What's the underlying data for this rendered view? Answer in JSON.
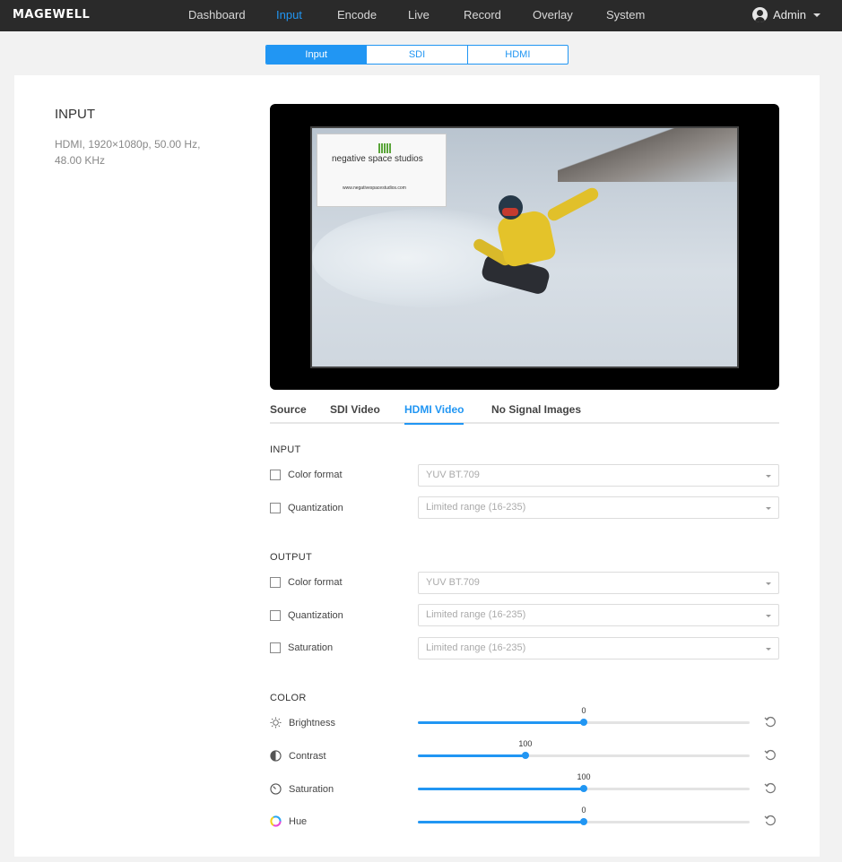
{
  "brand": "MAGEWELL",
  "nav": {
    "items": [
      "Dashboard",
      "Input",
      "Encode",
      "Live",
      "Record",
      "Overlay",
      "System"
    ],
    "active": "Input",
    "user": "Admin"
  },
  "segment_tabs": [
    "Input",
    "SDI",
    "HDMI"
  ],
  "segment_active": "Input",
  "side": {
    "title": "INPUT",
    "info": "HDMI, 1920×1080p, 50.00 Hz, 48.00 KHz"
  },
  "preview": {
    "logo_title": "negative space studios",
    "logo_url": "www.negativespacestudios.com"
  },
  "content_tabs": [
    "Source",
    "SDI Video",
    "HDMI Video",
    "No Signal Images"
  ],
  "content_tab_active": "HDMI Video",
  "input_section": {
    "label": "INPUT",
    "rows": [
      {
        "label": "Color format",
        "value": "YUV BT.709"
      },
      {
        "label": "Quantization",
        "value": "Limited range (16-235)"
      }
    ]
  },
  "output_section": {
    "label": "OUTPUT",
    "rows": [
      {
        "label": "Color format",
        "value": "YUV BT.709"
      },
      {
        "label": "Quantization",
        "value": "Limited range (16-235)"
      },
      {
        "label": "Saturation",
        "value": "Limited range (16-235)"
      }
    ]
  },
  "color_section": {
    "label": "COLOR",
    "sliders": [
      {
        "label": "Brightness",
        "value": "0",
        "fraction": 0.5,
        "icon": "sun-icon"
      },
      {
        "label": "Contrast",
        "value": "100",
        "fraction": 0.324,
        "icon": "contrast-icon"
      },
      {
        "label": "Saturation",
        "value": "100",
        "fraction": 0.5,
        "icon": "saturation-icon"
      },
      {
        "label": "Hue",
        "value": "0",
        "fraction": 0.5,
        "icon": "hue-icon"
      }
    ]
  },
  "colors": {
    "accent": "#2196f3",
    "topbar": "#2a2a2a"
  }
}
